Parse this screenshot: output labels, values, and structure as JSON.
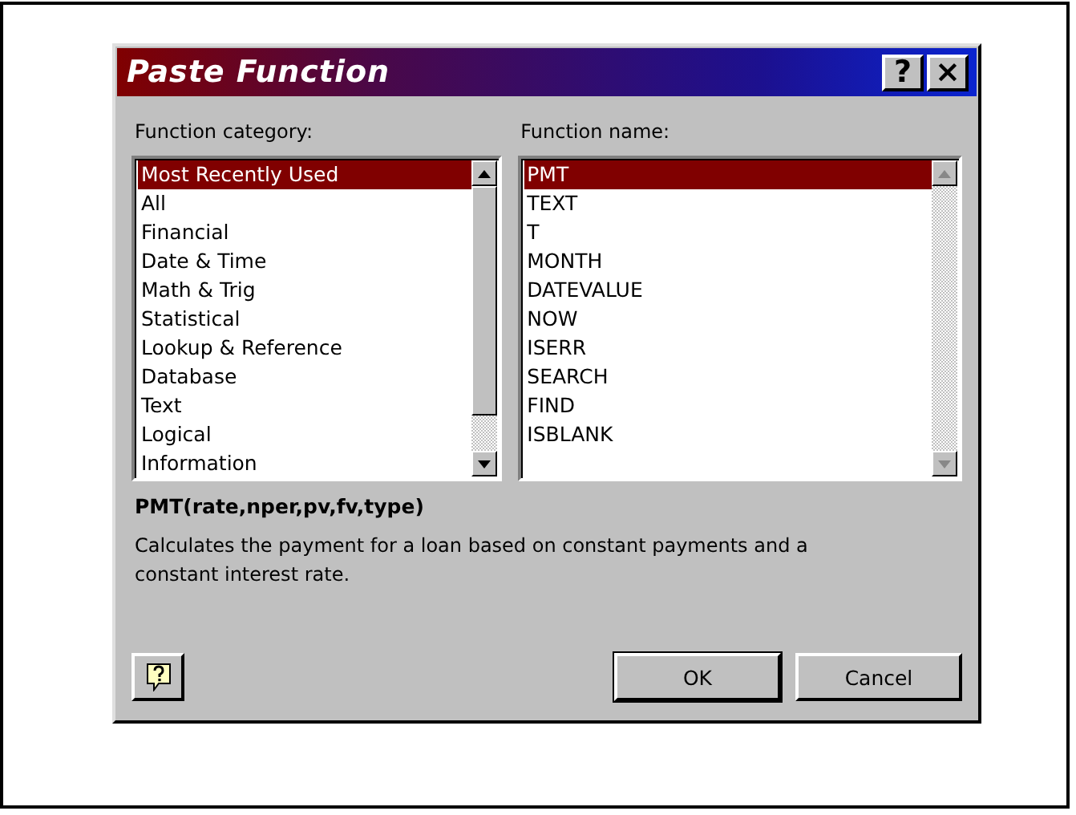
{
  "window": {
    "title": "Paste Function",
    "title_buttons": [
      "?",
      "×"
    ]
  },
  "category_list": {
    "label": "Function category:",
    "items": [
      {
        "label": "Most Recently Used",
        "selected": true
      },
      {
        "label": "All",
        "selected": false
      },
      {
        "label": "Financial",
        "selected": false
      },
      {
        "label": "Date & Time",
        "selected": false
      },
      {
        "label": "Math & Trig",
        "selected": false
      },
      {
        "label": "Statistical",
        "selected": false
      },
      {
        "label": "Lookup & Reference",
        "selected": false
      },
      {
        "label": "Database",
        "selected": false
      },
      {
        "label": "Text",
        "selected": false
      },
      {
        "label": "Logical",
        "selected": false
      },
      {
        "label": "Information",
        "selected": false
      }
    ]
  },
  "function_list": {
    "label": "Function name:",
    "items": [
      {
        "label": "PMT",
        "selected": true
      },
      {
        "label": "TEXT",
        "selected": false
      },
      {
        "label": "T",
        "selected": false
      },
      {
        "label": "MONTH",
        "selected": false
      },
      {
        "label": "DATEVALUE",
        "selected": false
      },
      {
        "label": "NOW",
        "selected": false
      },
      {
        "label": "ISERR",
        "selected": false
      },
      {
        "label": "SEARCH",
        "selected": false
      },
      {
        "label": "FIND",
        "selected": false
      },
      {
        "label": "ISBLANK",
        "selected": false
      }
    ]
  },
  "syntax": "PMT(rate,nper,pv,fv,type)",
  "description": "Calculates the payment for a loan based on constant payments and a constant interest rate.",
  "buttons": [
    "OK",
    "Cancel"
  ]
}
